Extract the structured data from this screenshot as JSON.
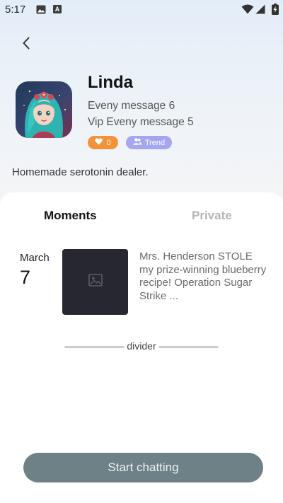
{
  "status_bar": {
    "time": "5:17",
    "a_label": "A",
    "icons": [
      "gallery-icon",
      "a-notification-icon",
      "wifi-icon",
      "signal-icon",
      "battery-charging-icon"
    ]
  },
  "header": {
    "back_icon": "chevron-left-icon"
  },
  "profile": {
    "name": "Linda",
    "stat_1": "Eveny message 6",
    "stat_2": "Vip Eveny message 5",
    "likes_count": "0",
    "trend_label": "Trend",
    "bio": "Homemade serotonin dealer."
  },
  "tabs": [
    {
      "label": "Moments",
      "active": true
    },
    {
      "label": "Private",
      "active": false
    }
  ],
  "post": {
    "month": "March",
    "day": "7",
    "text": "Mrs. Henderson STOLE my prize-winning blueberry recipe! Operation Sugar Strike ...",
    "thumb_icon": "image-placeholder-icon"
  },
  "divider_text": "—————— divider ——————",
  "cta": {
    "label": "Start chatting"
  },
  "colors": {
    "likes_badge": "#f2933b",
    "trend_badge": "#a5a6f0",
    "cta_bg": "#6e8186",
    "thumb_bg": "#262730"
  }
}
